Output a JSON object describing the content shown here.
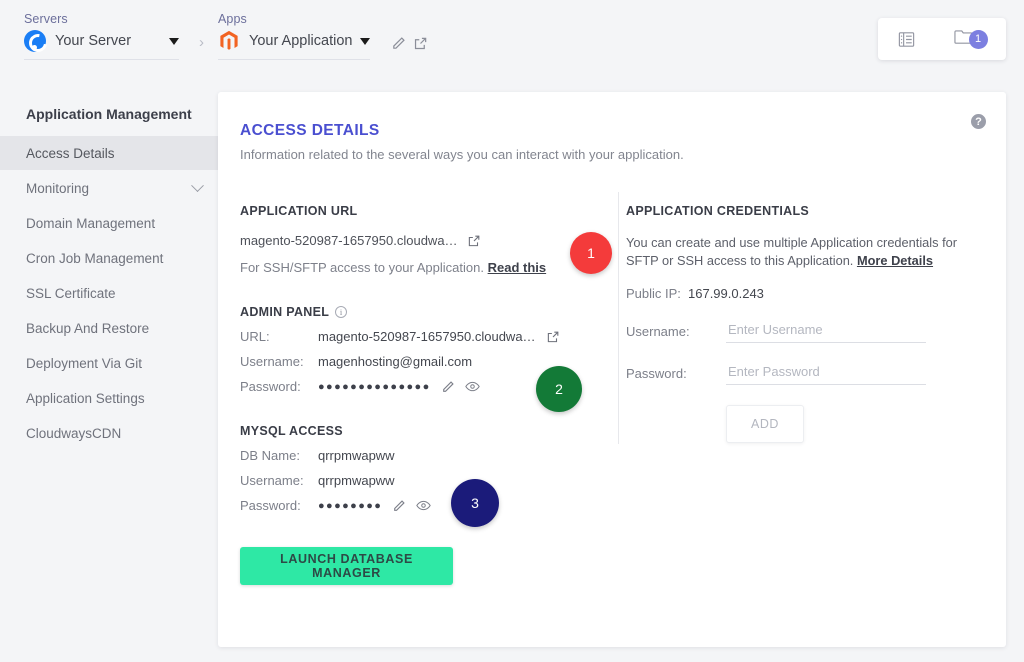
{
  "breadcrumb": {
    "server": {
      "label": "Servers",
      "name": "Your Server",
      "icon": "digitalocean-logo"
    },
    "app": {
      "label": "Apps",
      "name": "Your Application",
      "icon": "magento-logo"
    },
    "separator": "›",
    "edit_icon": "pencil-icon",
    "open_icon": "external-link-icon"
  },
  "topright": {
    "list_icon": "list-icon",
    "folder_icon": "folder-icon",
    "badge_count": "1",
    "badge_color": "#7c7fe0"
  },
  "sidebar": {
    "title": "Application Management",
    "items": [
      {
        "label": "Access Details",
        "active": true,
        "chevron": false
      },
      {
        "label": "Monitoring",
        "active": false,
        "chevron": true
      },
      {
        "label": "Domain Management",
        "active": false,
        "chevron": false
      },
      {
        "label": "Cron Job Management",
        "active": false,
        "chevron": false
      },
      {
        "label": "SSL Certificate",
        "active": false,
        "chevron": false
      },
      {
        "label": "Backup And Restore",
        "active": false,
        "chevron": false
      },
      {
        "label": "Deployment Via Git",
        "active": false,
        "chevron": false
      },
      {
        "label": "Application Settings",
        "active": false,
        "chevron": false
      },
      {
        "label": "CloudwaysCDN",
        "active": false,
        "chevron": false
      }
    ]
  },
  "card": {
    "title": "ACCESS DETAILS",
    "subtitle": "Information related to the several ways you can interact with your application.",
    "help_icon": "question-mark-icon"
  },
  "application_url": {
    "heading": "APPLICATION URL",
    "url": "magento-520987-1657950.cloudwa…",
    "open_icon": "external-link-icon",
    "note_text": "For SSH/SFTP access to your Application.",
    "note_link": "Read this"
  },
  "admin_panel": {
    "heading": "ADMIN PANEL",
    "info_icon": "info-circle-icon",
    "url_label": "URL:",
    "url_value": "magento-520987-1657950.cloudwa…",
    "open_icon": "external-link-icon",
    "username_label": "Username:",
    "username_value": "magenhosting@gmail.com",
    "password_label": "Password:",
    "password_masked": "●●●●●●●●●●●●●●",
    "edit_icon": "pencil-icon",
    "reveal_icon": "eye-icon"
  },
  "mysql_access": {
    "heading": "MYSQL ACCESS",
    "dbname_label": "DB Name:",
    "dbname_value": "qrrpmwapww",
    "username_label": "Username:",
    "username_value": "qrrpmwapww",
    "password_label": "Password:",
    "password_masked": "●●●●●●●●",
    "edit_icon": "pencil-icon",
    "reveal_icon": "eye-icon",
    "launch_button": "LAUNCH DATABASE MANAGER"
  },
  "application_credentials": {
    "heading": "APPLICATION CREDENTIALS",
    "description": "You can create and use multiple Application credentials for SFTP or SSH access to this Application.",
    "description_link": "More Details",
    "public_ip_label": "Public IP:",
    "public_ip_value": "167.99.0.243",
    "username_label": "Username:",
    "username_placeholder": "Enter Username",
    "username_value": "",
    "password_label": "Password:",
    "password_placeholder": "Enter Password",
    "password_value": "",
    "add_button": "ADD"
  },
  "markers": [
    {
      "number": "1",
      "color": "#f43b3b"
    },
    {
      "number": "2",
      "color": "#137a37"
    },
    {
      "number": "3",
      "color": "#1b1b7a"
    }
  ]
}
